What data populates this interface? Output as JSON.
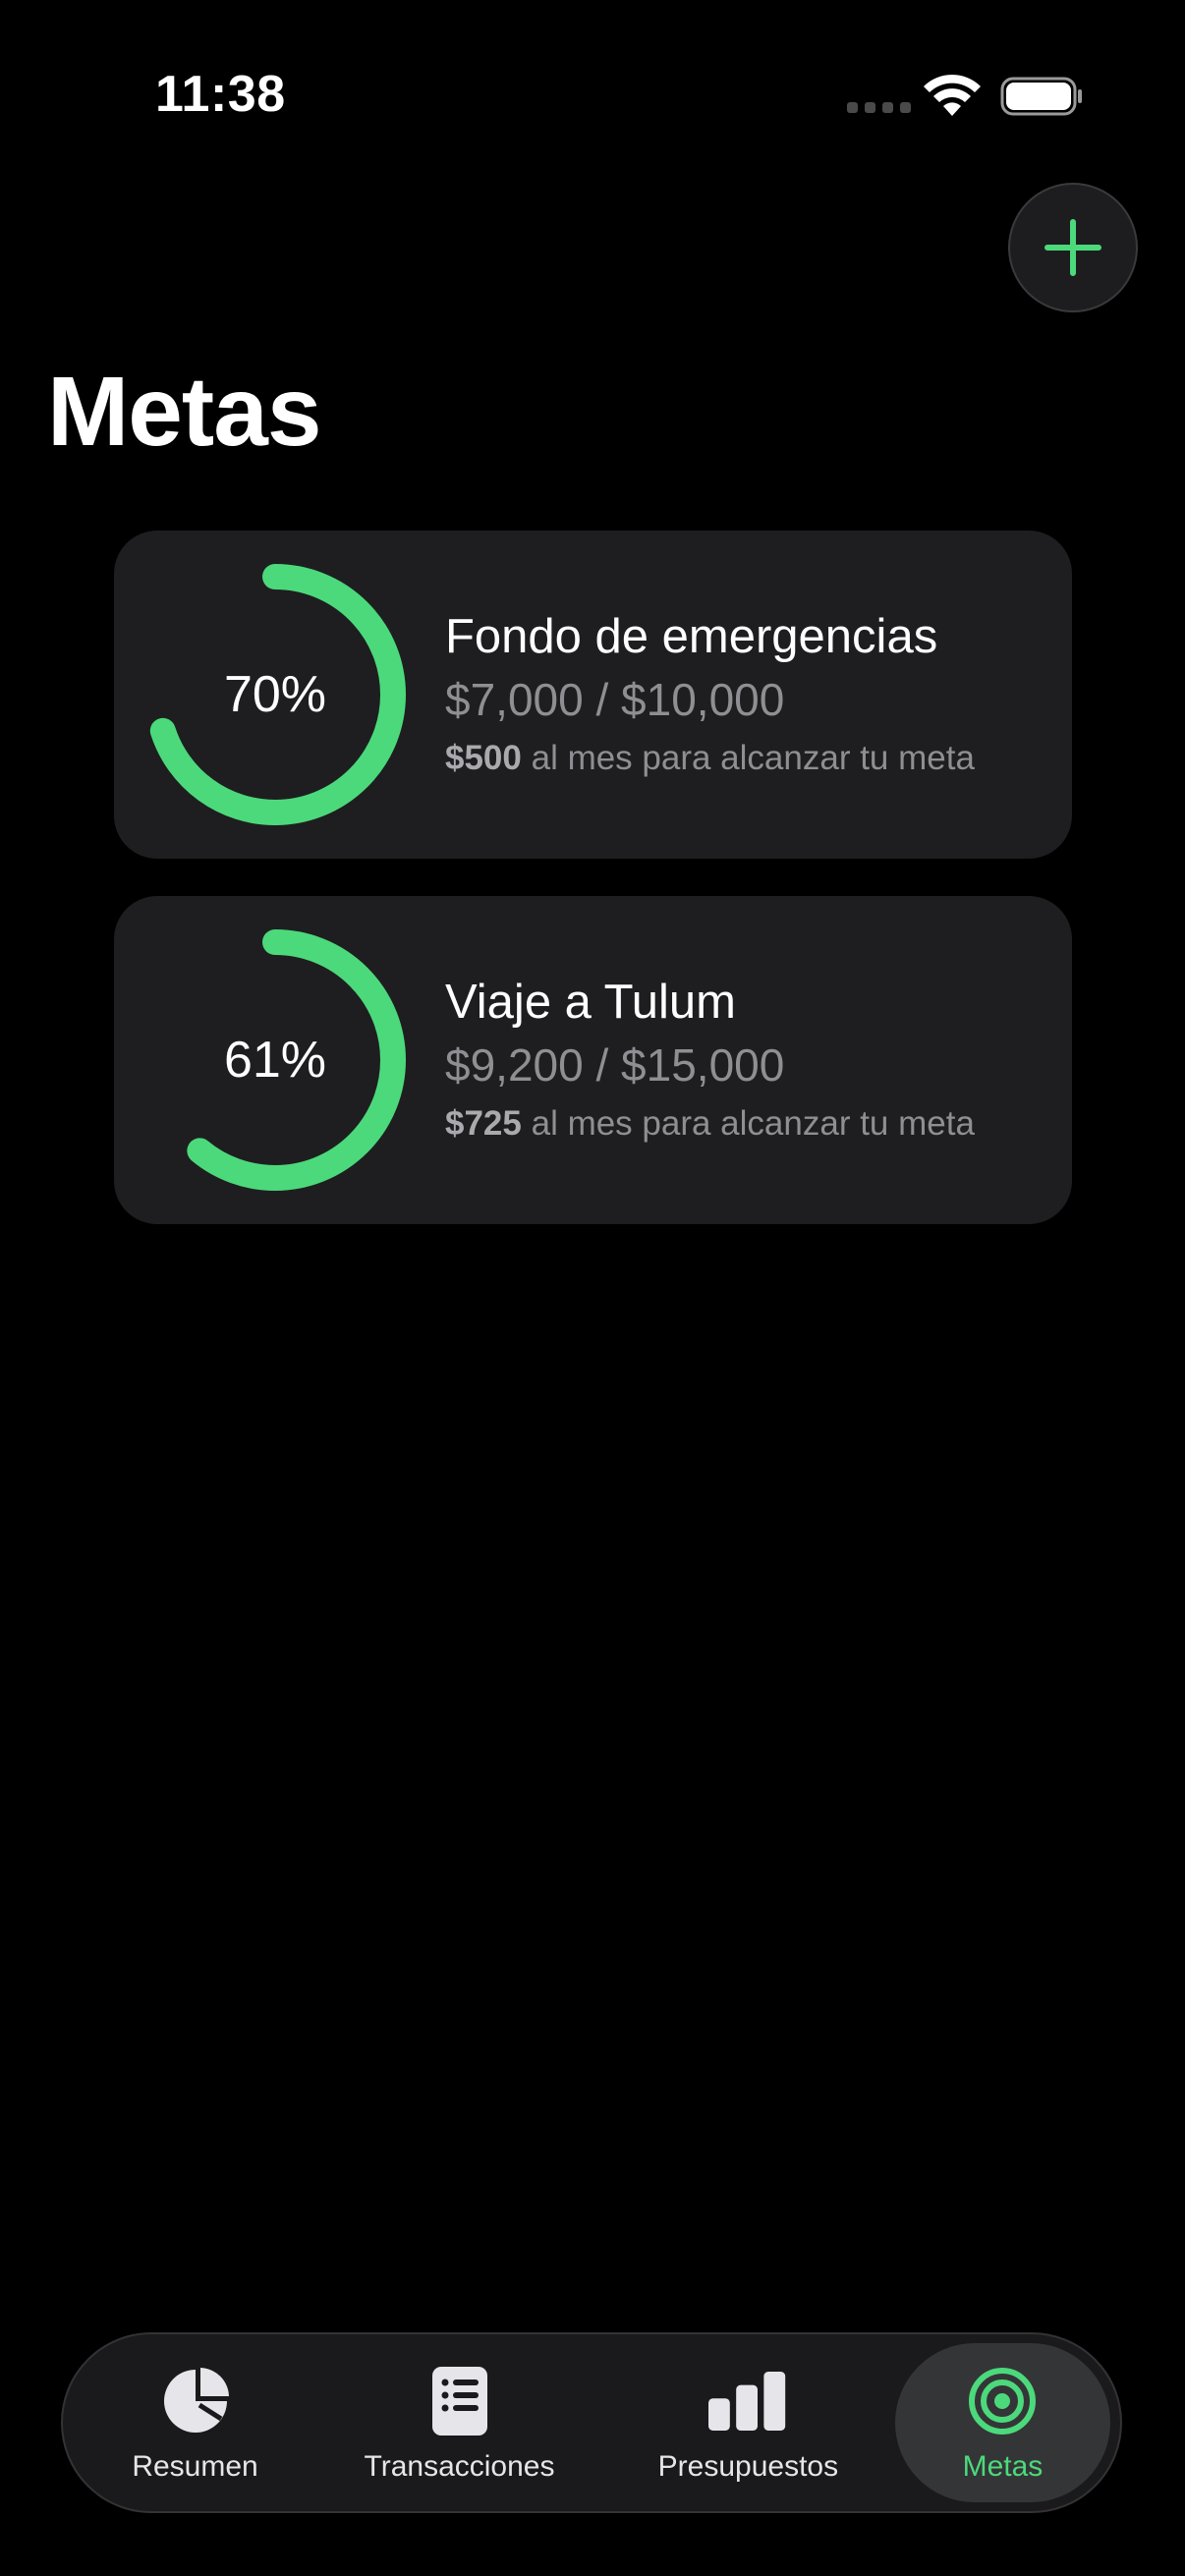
{
  "status_bar": {
    "time": "11:38"
  },
  "header": {
    "title": "Metas",
    "add_icon": "plus-icon"
  },
  "colors": {
    "accent": "#4cd97b",
    "card": "#1e1e20",
    "muted": "#8e8e93"
  },
  "goals": [
    {
      "percent_label": "70%",
      "progress": 0.7,
      "name": "Fondo de emergencias",
      "amount": "$7,000 / $10,000",
      "monthly_value": "$500",
      "monthly_text": " al mes para alcanzar tu meta"
    },
    {
      "percent_label": "61%",
      "progress": 0.61,
      "name": "Viaje a Tulum",
      "amount": "$9,200 / $15,000",
      "monthly_value": "$725",
      "monthly_text": " al mes para alcanzar tu meta"
    }
  ],
  "tab_bar": {
    "tabs": [
      {
        "label": "Resumen",
        "icon": "pie-chart-icon"
      },
      {
        "label": "Transacciones",
        "icon": "list-icon"
      },
      {
        "label": "Presupuestos",
        "icon": "bar-chart-icon"
      },
      {
        "label": "Metas",
        "icon": "target-icon",
        "active": true
      }
    ]
  }
}
